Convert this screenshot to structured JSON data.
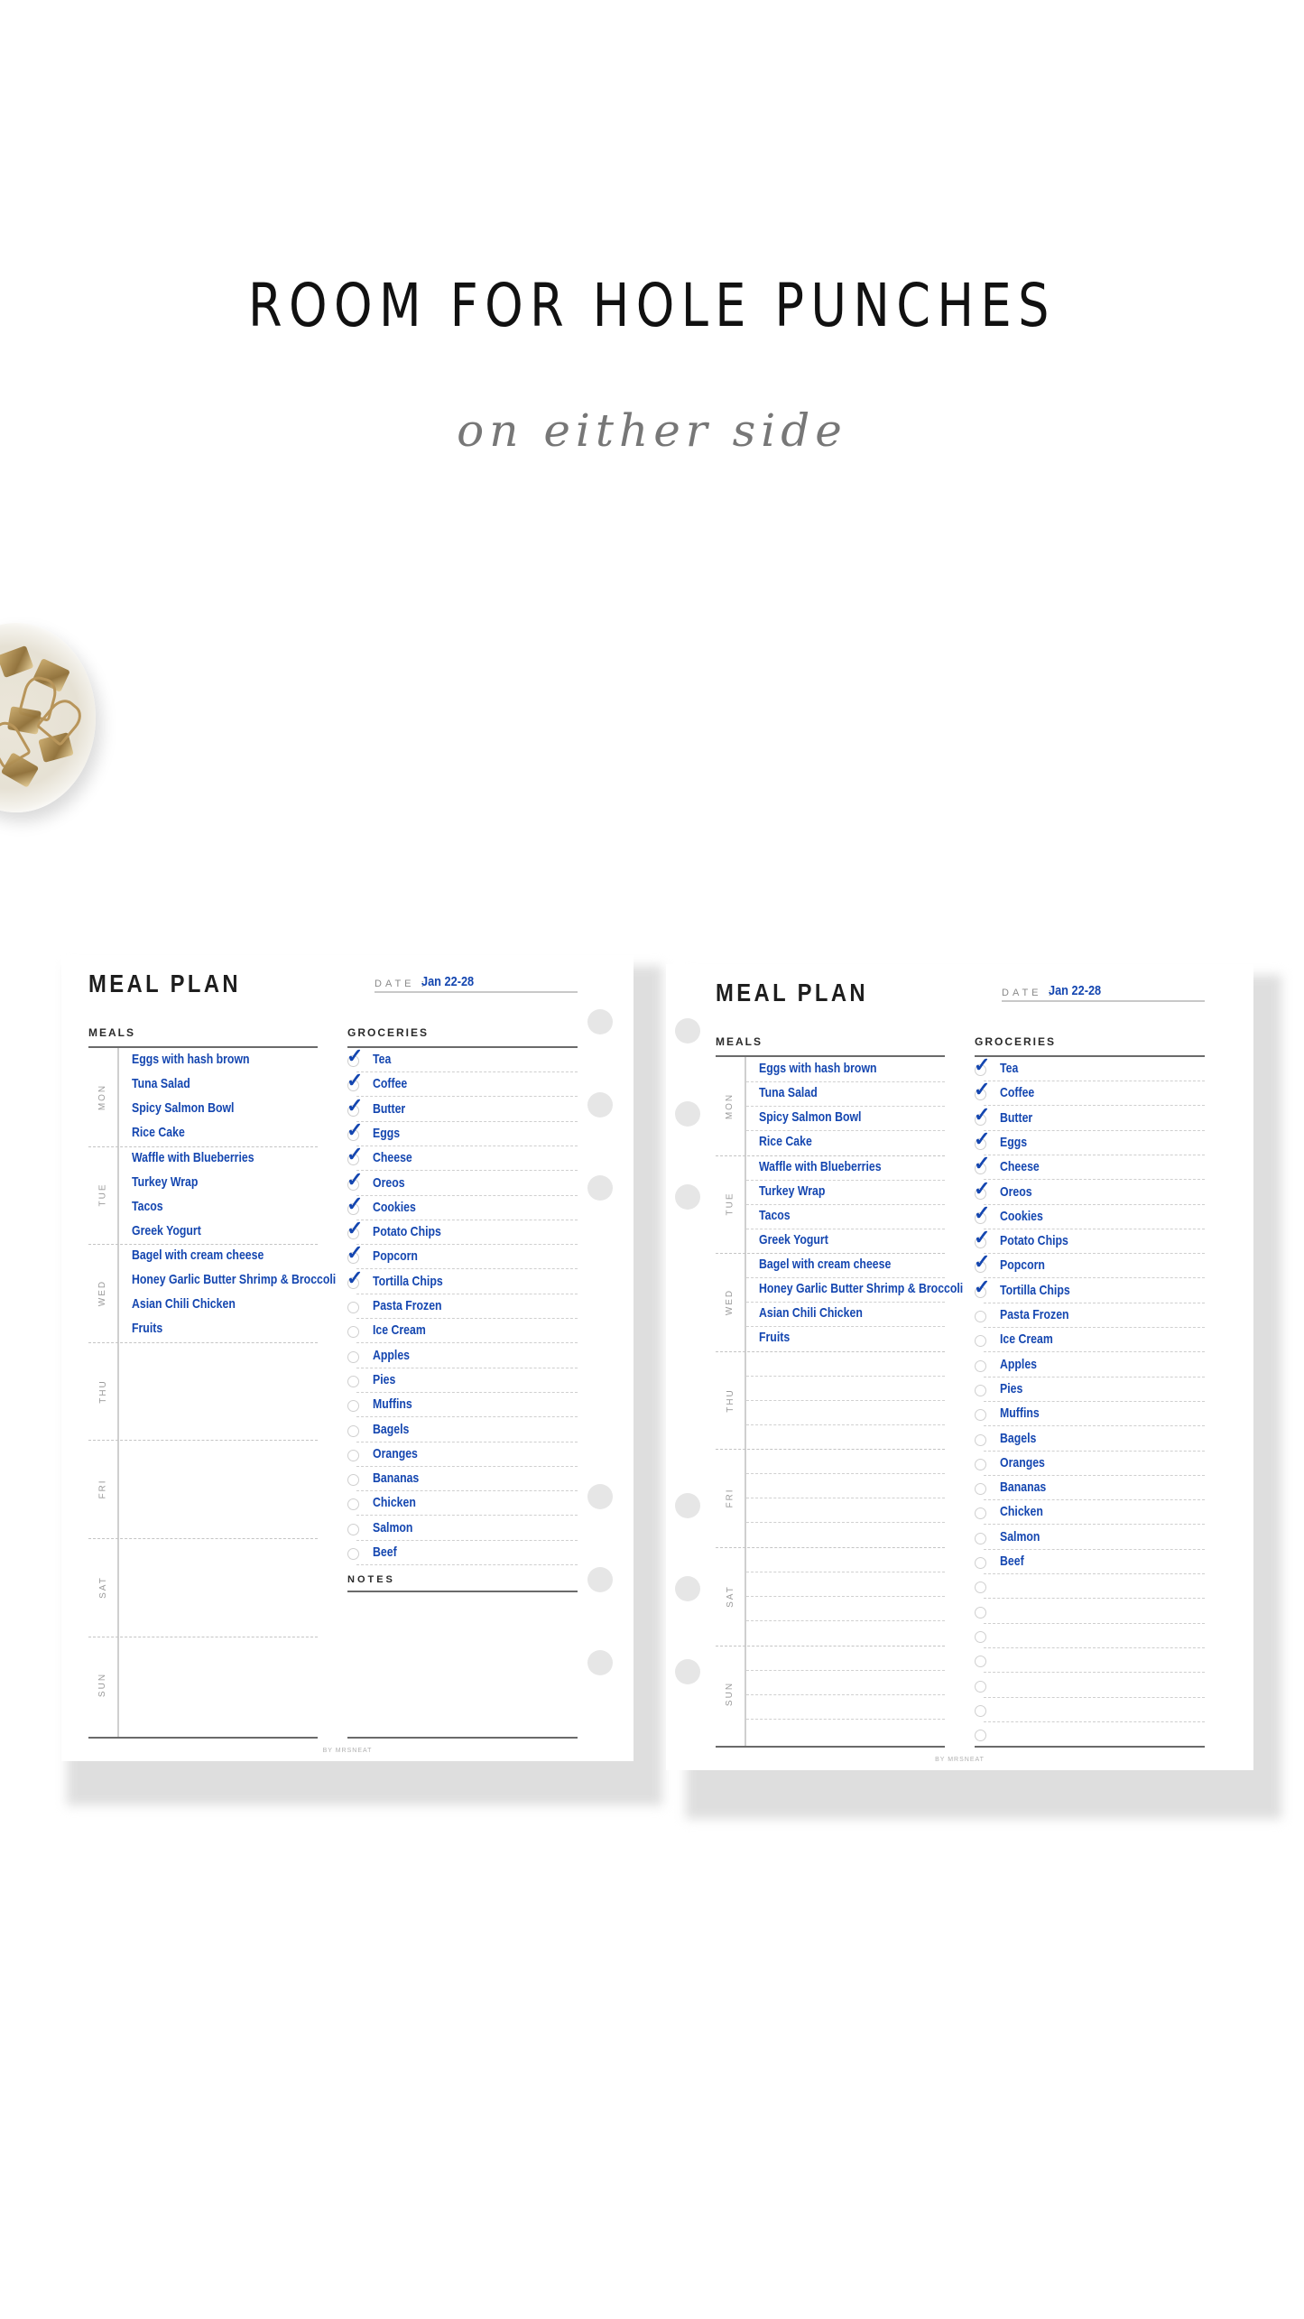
{
  "headline": "ROOM FOR HOLE PUNCHES",
  "subline": "on either side",
  "colors": {
    "ink_blue": "#1446b0",
    "hole_gray": "#e6e6e6",
    "rule_gray": "#6a6a6a"
  },
  "pages": [
    {
      "title": "MEAL PLAN",
      "date_label": "DATE :",
      "date_value": "Jan 22-28",
      "meals_label": "MEALS",
      "groceries_label": "GROCERIES",
      "notes_label": "NOTES",
      "footer": "BY MRSNEAT",
      "days": [
        {
          "label": "MON",
          "meals": [
            "Eggs with hash brown",
            "Tuna Salad",
            "Spicy Salmon Bowl",
            "Rice Cake"
          ]
        },
        {
          "label": "TUE",
          "meals": [
            "Waffle with Blueberries",
            "Turkey Wrap",
            "Tacos",
            "Greek Yogurt"
          ]
        },
        {
          "label": "WED",
          "meals": [
            "Bagel with cream cheese",
            "Honey Garlic Butter Shrimp & Broccoli",
            "Asian Chili Chicken",
            "Fruits"
          ]
        },
        {
          "label": "THU",
          "meals": []
        },
        {
          "label": "FRI",
          "meals": []
        },
        {
          "label": "SAT",
          "meals": []
        },
        {
          "label": "SUN",
          "meals": []
        }
      ],
      "groceries": [
        {
          "name": "Tea",
          "checked": true
        },
        {
          "name": "Coffee",
          "checked": true
        },
        {
          "name": "Butter",
          "checked": true
        },
        {
          "name": "Eggs",
          "checked": true
        },
        {
          "name": "Cheese",
          "checked": true
        },
        {
          "name": "Oreos",
          "checked": true
        },
        {
          "name": "Cookies",
          "checked": true
        },
        {
          "name": "Potato Chips",
          "checked": true
        },
        {
          "name": "Popcorn",
          "checked": true
        },
        {
          "name": "Tortilla Chips",
          "checked": true
        },
        {
          "name": "Pasta Frozen",
          "checked": false
        },
        {
          "name": "Ice Cream",
          "checked": false
        },
        {
          "name": "Apples",
          "checked": false
        },
        {
          "name": "Pies",
          "checked": false
        },
        {
          "name": "Muffins",
          "checked": false
        },
        {
          "name": "Bagels",
          "checked": false
        },
        {
          "name": "Oranges",
          "checked": false
        },
        {
          "name": "Bananas",
          "checked": false
        },
        {
          "name": "Chicken",
          "checked": false
        },
        {
          "name": "Salmon",
          "checked": false
        },
        {
          "name": "Beef",
          "checked": false
        }
      ],
      "empty_grocery_rows": 0,
      "has_notes": true,
      "lined_meals": false
    },
    {
      "title": "MEAL PLAN",
      "date_label": "DATE :",
      "date_value": "Jan 22-28",
      "meals_label": "MEALS",
      "groceries_label": "GROCERIES",
      "footer": "BY MRSNEAT",
      "days": [
        {
          "label": "MON",
          "meals": [
            "Eggs with hash brown",
            "Tuna Salad",
            "Spicy Salmon Bowl",
            "Rice Cake"
          ]
        },
        {
          "label": "TUE",
          "meals": [
            "Waffle with Blueberries",
            "Turkey Wrap",
            "Tacos",
            "Greek Yogurt"
          ]
        },
        {
          "label": "WED",
          "meals": [
            "Bagel with cream cheese",
            "Honey Garlic Butter Shrimp & Broccoli",
            "Asian Chili Chicken",
            "Fruits"
          ]
        },
        {
          "label": "THU",
          "meals": []
        },
        {
          "label": "FRI",
          "meals": []
        },
        {
          "label": "SAT",
          "meals": []
        },
        {
          "label": "SUN",
          "meals": []
        }
      ],
      "groceries": [
        {
          "name": "Tea",
          "checked": true
        },
        {
          "name": "Coffee",
          "checked": true
        },
        {
          "name": "Butter",
          "checked": true
        },
        {
          "name": "Eggs",
          "checked": true
        },
        {
          "name": "Cheese",
          "checked": true
        },
        {
          "name": "Oreos",
          "checked": true
        },
        {
          "name": "Cookies",
          "checked": true
        },
        {
          "name": "Potato Chips",
          "checked": true
        },
        {
          "name": "Popcorn",
          "checked": true
        },
        {
          "name": "Tortilla Chips",
          "checked": true
        },
        {
          "name": "Pasta Frozen",
          "checked": false
        },
        {
          "name": "Ice Cream",
          "checked": false
        },
        {
          "name": "Apples",
          "checked": false
        },
        {
          "name": "Pies",
          "checked": false
        },
        {
          "name": "Muffins",
          "checked": false
        },
        {
          "name": "Bagels",
          "checked": false
        },
        {
          "name": "Oranges",
          "checked": false
        },
        {
          "name": "Bananas",
          "checked": false
        },
        {
          "name": "Chicken",
          "checked": false
        },
        {
          "name": "Salmon",
          "checked": false
        },
        {
          "name": "Beef",
          "checked": false
        }
      ],
      "empty_grocery_rows": 7,
      "has_notes": false,
      "lined_meals": true
    }
  ]
}
